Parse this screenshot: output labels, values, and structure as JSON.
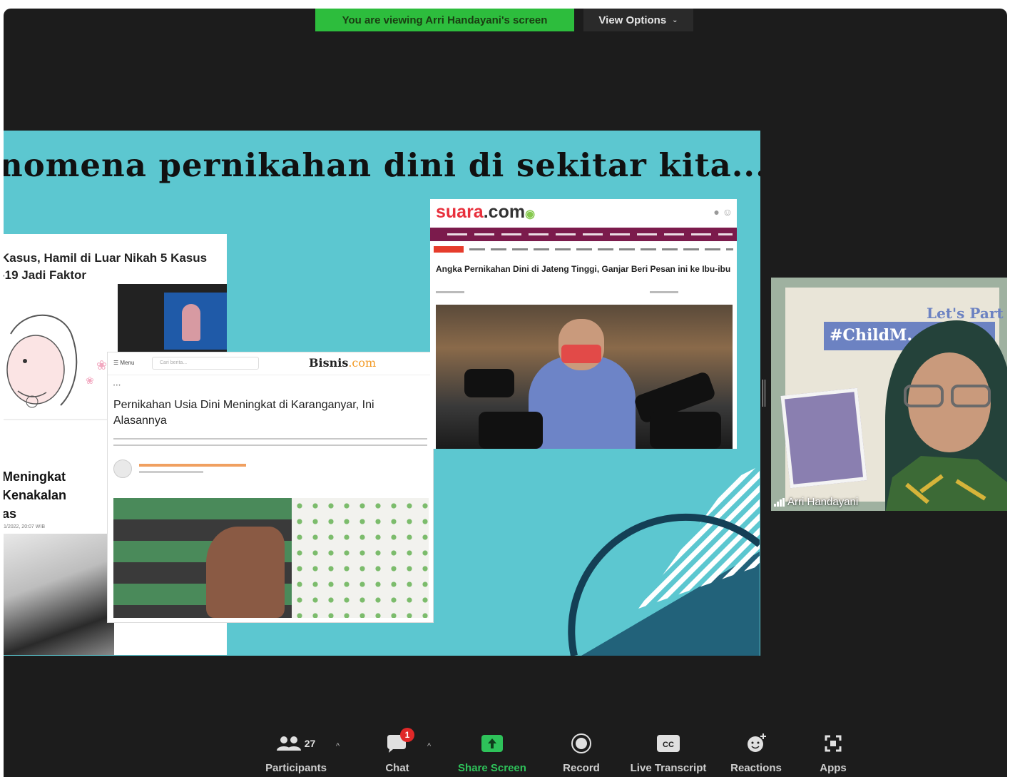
{
  "banner": {
    "viewing_text": "You are viewing Arri Handayani's screen",
    "view_options_label": "View Options"
  },
  "slide": {
    "title": "nomena pernikahan dini di sekitar kita....",
    "article_left": {
      "headline": "Kasus, Hamil di Luar Nikah 5 Kasus\n-19 Jadi Faktor",
      "headline2": "Meningkat\nKenakalan\nas",
      "date": "1/2022, 20:07 WIB"
    },
    "article_bisnis": {
      "logo": "Bisnis",
      "logo_suffix": ".com",
      "menu_label": "Menu",
      "search_placeholder": "Cari berita...",
      "headline": "Pernikahan Usia Dini Meningkat di Karanganyar, Ini Alasannya"
    },
    "article_suara": {
      "logo": "suara",
      "logo_suffix": ".com",
      "headline": "Angka Pernikahan Dini di Jateng Tinggi, Ganjar Beri Pesan ini ke Ibu-ibu"
    }
  },
  "video": {
    "participant_name": "Arri Handayani",
    "background_hashtag": "#ChildM...rev",
    "background_text": "Let's Part"
  },
  "toolbar": {
    "participants_label": "Participants",
    "participants_count": "27",
    "chat_label": "Chat",
    "chat_badge": "1",
    "share_label": "Share Screen",
    "record_label": "Record",
    "transcript_label": "Live Transcript",
    "reactions_label": "Reactions",
    "apps_label": "Apps",
    "cc_text": "CC"
  },
  "colors": {
    "banner_green": "#2dbd3d",
    "slide_teal": "#5cc7d0",
    "share_green": "#2ec25a",
    "badge_red": "#e02828"
  }
}
